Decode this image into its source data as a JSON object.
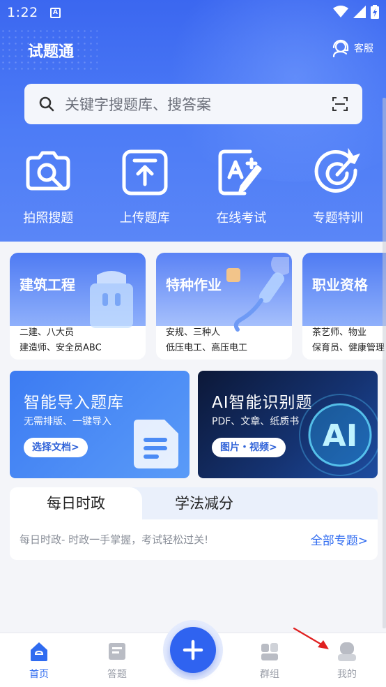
{
  "status": {
    "time": "1:22"
  },
  "header": {
    "title": "试题通",
    "service_label": "客服"
  },
  "search": {
    "placeholder": "关键字搜题库、搜答案"
  },
  "quick_actions": [
    {
      "label": "拍照搜题",
      "icon": "camera-search-icon"
    },
    {
      "label": "上传题库",
      "icon": "upload-icon"
    },
    {
      "label": "在线考试",
      "icon": "exam-edit-icon"
    },
    {
      "label": "专题特训",
      "icon": "target-icon"
    }
  ],
  "categories": [
    {
      "title": "建筑工程",
      "line1": "二建、八大员",
      "line2": "建造师、安全员ABC"
    },
    {
      "title": "特种作业",
      "line1": "安规、三种人",
      "line2": "低压电工、高压电工"
    },
    {
      "title": "职业资格",
      "line1": "茶艺师、物业",
      "line2": "保育员、健康管理"
    }
  ],
  "promos": [
    {
      "title": "智能导入题库",
      "subtitle": "无需排版、一键导入",
      "button": "选择文档>"
    },
    {
      "title": "AI智能识别题",
      "subtitle": "PDF、文章、纸质书",
      "button": "图片・视频>"
    }
  ],
  "news": {
    "tabs": [
      "每日时政",
      "学法减分"
    ],
    "description": "每日时政- 时政一手掌握，考试轻松过关!",
    "more": "全部专题>"
  },
  "bottom_nav": [
    {
      "label": "首页",
      "icon": "home-icon",
      "active": true
    },
    {
      "label": "答题",
      "icon": "answer-icon",
      "active": false
    },
    {
      "label": "群组",
      "icon": "group-icon",
      "active": false
    },
    {
      "label": "我的",
      "icon": "profile-icon",
      "active": false
    }
  ],
  "colors": {
    "primary": "#2f63f0",
    "accent_text": "#2f6bf0",
    "header_top": "#3b67f0"
  }
}
